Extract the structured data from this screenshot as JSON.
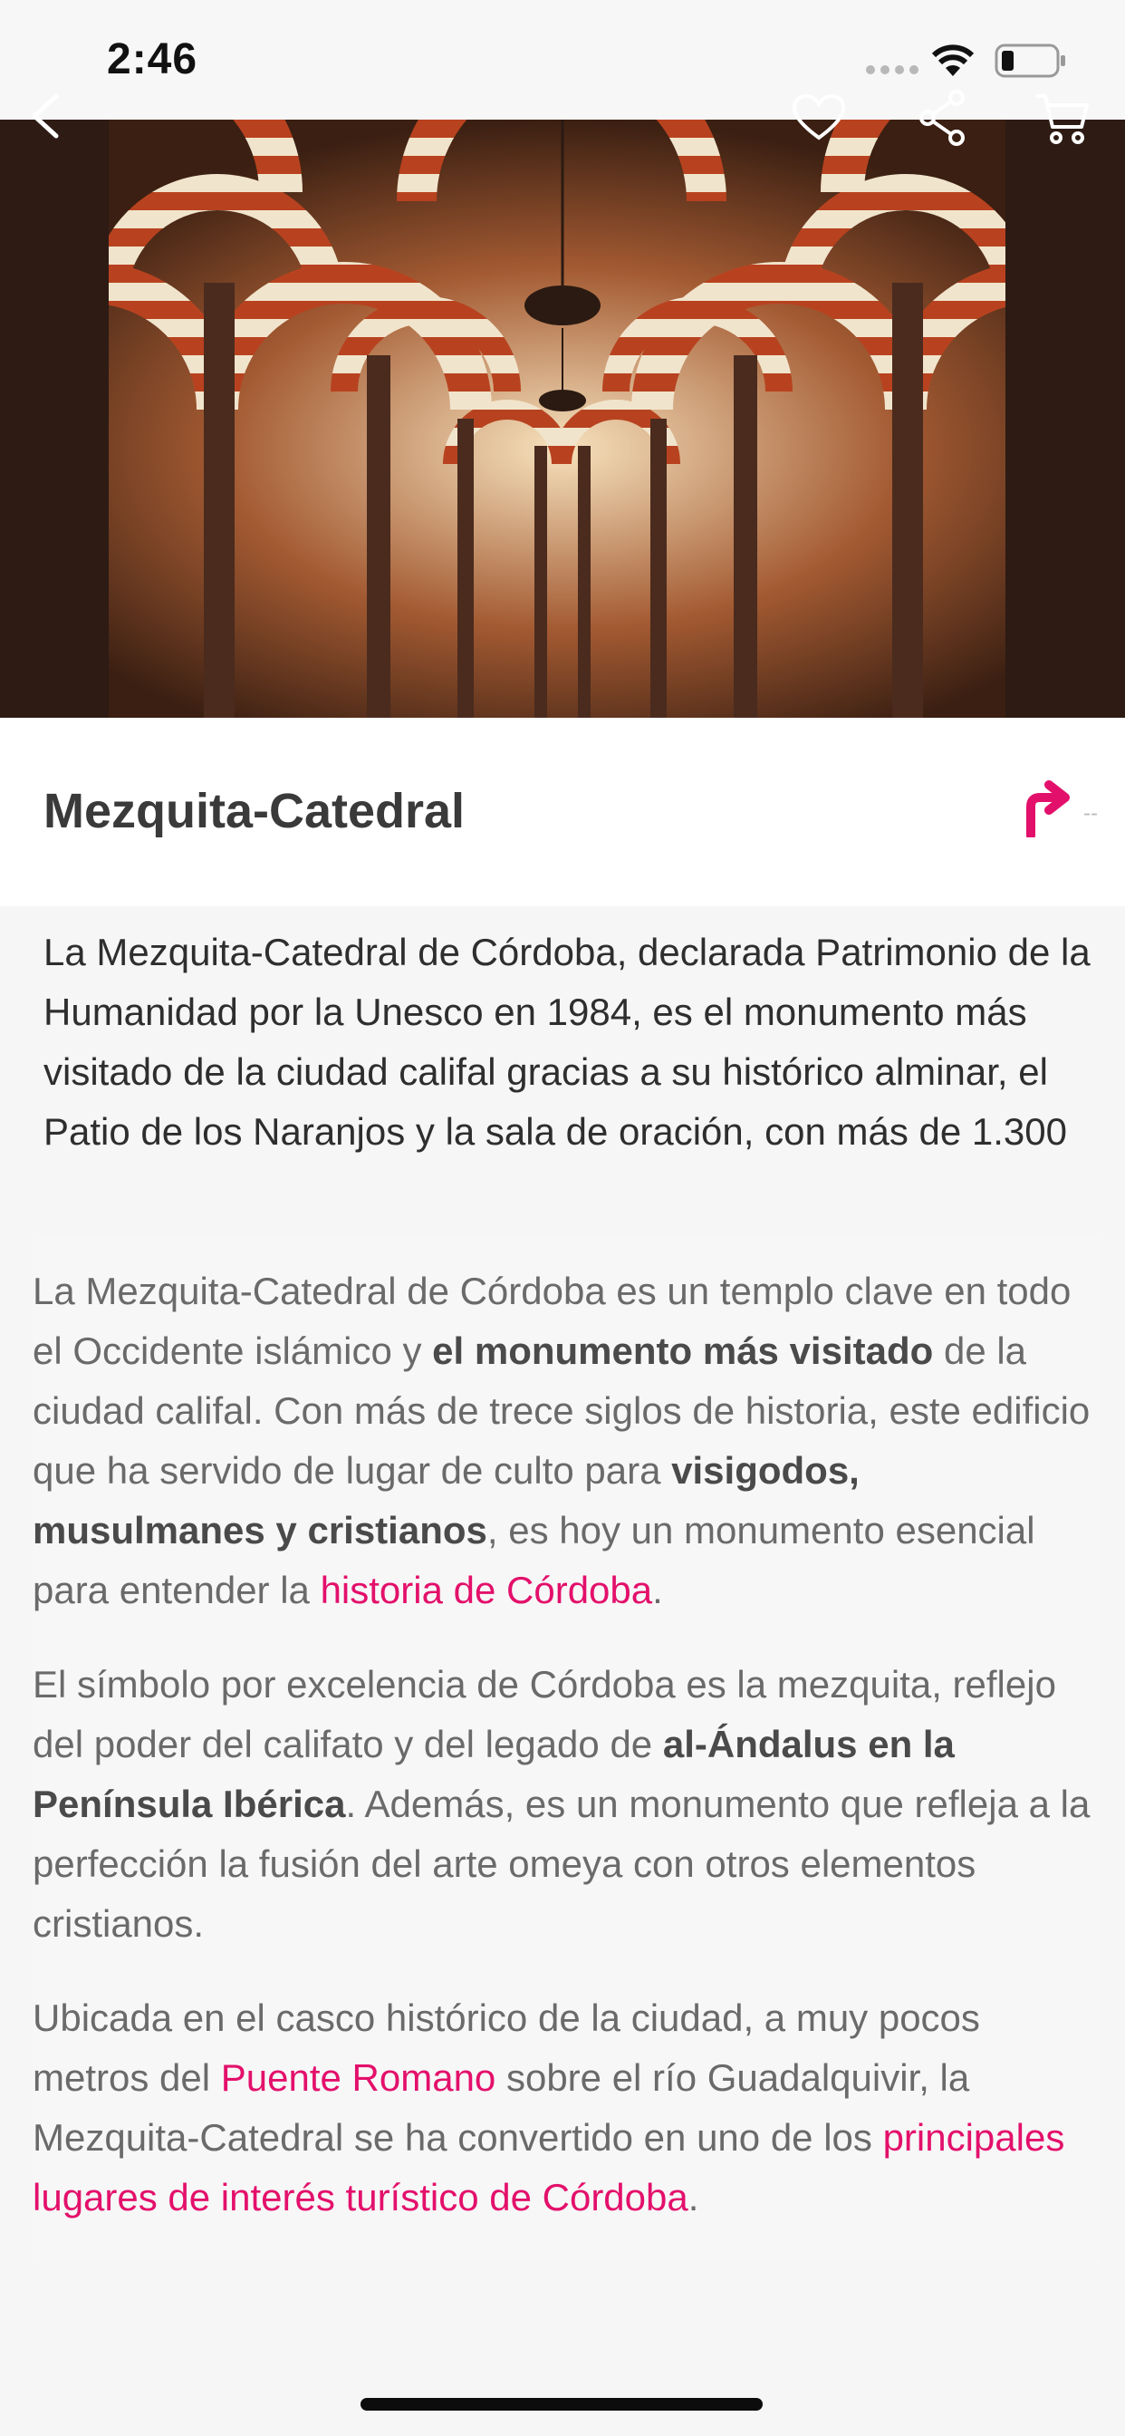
{
  "status_bar": {
    "time": "2:46"
  },
  "header": {
    "back_icon": "chevron-left-icon",
    "favorite_icon": "heart-icon",
    "share_icon": "share-icon",
    "cart_icon": "cart-icon"
  },
  "place": {
    "title": "Mezquita-Catedral",
    "directions_icon": "directions-arrow-icon",
    "directions_dash": "--",
    "summary": "La Mezquita-Catedral de Córdoba, declarada Patrimonio de la Humanidad por la Unesco en 1984, es el monumento más visitado de la ciudad califal gracias a su histórico alminar, el Patio de los Naranjos y la sala de oración, con más de 1.300"
  },
  "article": {
    "p1": {
      "t1": "La Mezquita-Catedral de Córdoba es un templo clave en todo el Occidente islámico y ",
      "b1": "el monumento más visitado",
      "t2": " de la ciudad califal. Con más de trece siglos de historia, este edificio que ha servido de lugar de culto para ",
      "b2": "visigodos, musulmanes y cristianos",
      "t3": ", es hoy un monumento esencial para entender la ",
      "link1": "historia de Córdoba",
      "t4": "."
    },
    "p2": {
      "t1": "El símbolo por excelencia de Córdoba es la mezquita, reflejo del poder del califato y del legado de ",
      "b1": "al-Ándalus en la Península Ibérica",
      "t2": ". Además, es un monumento que refleja a la perfección la fusión del arte omeya con otros elementos cristianos."
    },
    "p3": {
      "t1": "Ubicada en el casco histórico de la ciudad, a muy pocos metros del ",
      "link1": "Puente Romano",
      "t2": " sobre el río Guadalquivir, la Mezquita-Catedral se ha convertido en uno de los ",
      "link2": "principales lugares de interés turístico de Córdoba",
      "t3": "."
    }
  },
  "colors": {
    "accent": "#e3106b",
    "background": "#f6f6f6"
  }
}
